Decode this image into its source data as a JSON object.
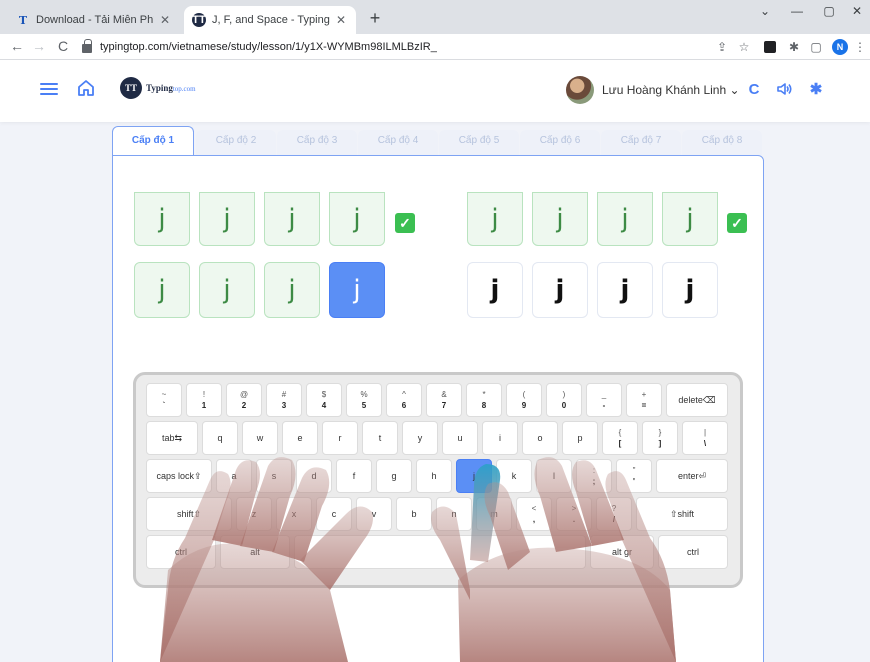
{
  "browser": {
    "tabs": [
      {
        "title": "Download - Tải Miễn Phí VN - Ph",
        "favicon": "T",
        "active": false
      },
      {
        "title": "J, F, and Space - TypingTop",
        "favicon": "TT",
        "active": true
      }
    ],
    "new_tab": "+",
    "url": "typingtop.com/vietnamese/study/lesson/1/y1X-WYMBm98ILMLBzIR_",
    "profile_initial": "N",
    "window_controls": [
      "⌄",
      "—",
      "▢",
      "✕"
    ]
  },
  "site": {
    "logo_mark": "TT",
    "logo_text": "Typing",
    "logo_domain": "top.com",
    "username": "Lưu Hoàng Khánh Linh",
    "dropdown": "⌄"
  },
  "levels": [
    "Cấp độ 1",
    "Cấp độ 2",
    "Cấp độ 3",
    "Cấp độ 4",
    "Cấp độ 5",
    "Cấp độ 6",
    "Cấp độ 7",
    "Cấp độ 8"
  ],
  "active_level": 0,
  "lesson": {
    "tile_char": "j",
    "check": "✓"
  },
  "keyboard": {
    "row1": [
      {
        "top": "~",
        "bot": "`"
      },
      {
        "top": "!",
        "bot": "1"
      },
      {
        "top": "@",
        "bot": "2"
      },
      {
        "top": "#",
        "bot": "3"
      },
      {
        "top": "$",
        "bot": "4"
      },
      {
        "top": "%",
        "bot": "5"
      },
      {
        "top": "^",
        "bot": "6"
      },
      {
        "top": "&",
        "bot": "7"
      },
      {
        "top": "*",
        "bot": "8"
      },
      {
        "top": "(",
        "bot": "9"
      },
      {
        "top": ")",
        "bot": "0"
      },
      {
        "top": "_",
        "bot": "-"
      },
      {
        "top": "+",
        "bot": "="
      }
    ],
    "delete": "delete⌫",
    "tab": "tab⇆",
    "row2": [
      "q",
      "w",
      "e",
      "r",
      "t",
      "y",
      "u",
      "i",
      "o",
      "p"
    ],
    "row2_extra": [
      {
        "top": "{",
        "bot": "["
      },
      {
        "top": "}",
        "bot": "]"
      },
      {
        "top": "|",
        "bot": "\\"
      }
    ],
    "caps": "caps lock⇪",
    "row3": [
      "a",
      "s",
      "d",
      "f",
      "g",
      "h",
      "j",
      "k",
      "l"
    ],
    "row3_extra": [
      {
        "top": ":",
        "bot": ";"
      },
      {
        "top": "\"",
        "bot": "'"
      }
    ],
    "enter": "enter⏎",
    "shift_l": "shift⇧",
    "row4": [
      "z",
      "x",
      "c",
      "v",
      "b",
      "n",
      "m"
    ],
    "row4_extra": [
      {
        "top": "<",
        "bot": ","
      },
      {
        "top": ">",
        "bot": "."
      },
      {
        "top": "?",
        "bot": "/"
      }
    ],
    "shift_r": "⇧shift",
    "ctrl_l": "ctrl",
    "alt": "alt",
    "altgr": "alt gr",
    "ctrl_r": "ctrl",
    "target_key": "j"
  },
  "colors": {
    "accent": "#4a7ff5",
    "done_bg": "#eef8ef",
    "check": "#3bbf52",
    "page_bg": "#f1f3f9"
  }
}
